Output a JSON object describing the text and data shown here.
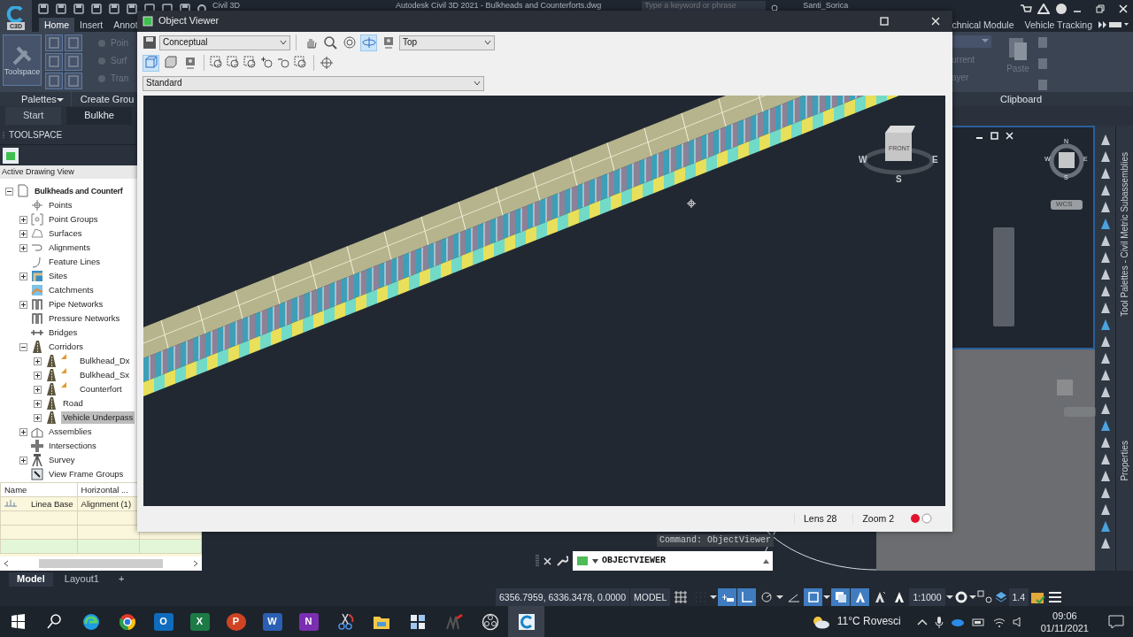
{
  "title_bar": {
    "app_badge": "C3D",
    "app_name": "Civil 3D",
    "document_title": "Autodesk Civil 3D 2021 - Bulkheads and Counterforts.dwg",
    "search": {
      "placeholder": "Type a keyword or phrase"
    },
    "user": "Santi_Sorica"
  },
  "ribbon_tabs_left": [
    {
      "label": "Home",
      "selected": true
    },
    {
      "label": "Insert",
      "selected": false
    },
    {
      "label": "Annot",
      "selected": false
    }
  ],
  "ribbon_tabs_right": [
    {
      "label": "chnical Module",
      "selected": false
    },
    {
      "label": "Vehicle Tracking",
      "selected": false
    }
  ],
  "ribbon_left": {
    "big_button": "Toolspace",
    "faded_items": [
      "Poin",
      "Surf",
      "Tran"
    ],
    "panel_labels": [
      "Palettes",
      "Create Grou"
    ]
  },
  "ribbon_right": {
    "faded_items": [
      "urrent",
      "ayer"
    ],
    "paste": "Paste",
    "panel_label": "Clipboard"
  },
  "file_tabs": [
    {
      "label": "Start",
      "selected": false
    },
    {
      "label": "Bulkhe",
      "selected": true
    }
  ],
  "toolspace": {
    "title": "TOOLSPACE",
    "view": "Active Drawing View",
    "tree": [
      {
        "label": "Bulkheads and Counterf",
        "kind": "document",
        "expanded": true,
        "selected": false,
        "children": [
          {
            "label": "Points",
            "kind": "points",
            "selected": false
          },
          {
            "label": "Point Groups",
            "kind": "point-groups",
            "expanded": false,
            "selected": false
          },
          {
            "label": "Surfaces",
            "kind": "surfaces",
            "expanded": false,
            "selected": false
          },
          {
            "label": "Alignments",
            "kind": "alignments",
            "expanded": false,
            "selected": false
          },
          {
            "label": "Feature Lines",
            "kind": "feature-lines",
            "selected": false
          },
          {
            "label": "Sites",
            "kind": "sites",
            "expanded": false,
            "selected": false
          },
          {
            "label": "Catchments",
            "kind": "catchments",
            "selected": false
          },
          {
            "label": "Pipe Networks",
            "kind": "pipes",
            "expanded": false,
            "selected": false
          },
          {
            "label": "Pressure Networks",
            "kind": "pipes",
            "selected": false
          },
          {
            "label": "Bridges",
            "kind": "bridges",
            "selected": false
          },
          {
            "label": "Corridors",
            "kind": "corridor",
            "expanded": true,
            "selected": false,
            "children": [
              {
                "label": "Bulkhead_Dx",
                "kind": "corridor",
                "flagged": true,
                "expanded": false,
                "selected": false
              },
              {
                "label": "Bulkhead_Sx",
                "kind": "corridor",
                "flagged": true,
                "expanded": false,
                "selected": false
              },
              {
                "label": "Counterfort",
                "kind": "corridor",
                "flagged": true,
                "expanded": false,
                "selected": false
              },
              {
                "label": "Road",
                "kind": "corridor",
                "flagged": false,
                "expanded": false,
                "selected": false
              },
              {
                "label": "Vehicle Underpass",
                "kind": "corridor",
                "flagged": false,
                "expanded": false,
                "selected": true
              }
            ]
          },
          {
            "label": "Assemblies",
            "kind": "assemblies",
            "expanded": false,
            "selected": false
          },
          {
            "label": "Intersections",
            "kind": "intersections",
            "selected": false
          },
          {
            "label": "Survey",
            "kind": "survey",
            "expanded": false,
            "selected": false
          },
          {
            "label": "View Frame Groups",
            "kind": "view-frames",
            "selected": false
          }
        ]
      }
    ],
    "table": {
      "columns": [
        "Name",
        "Horizontal ..."
      ],
      "rows": [
        [
          "Linea Base",
          "Alignment (1)"
        ]
      ]
    }
  },
  "object_viewer": {
    "title": "Object Viewer",
    "visual_style": "Conceptual",
    "view": "Top",
    "display": "Standard",
    "view_tools": [
      {
        "kind": "pan",
        "on": false
      },
      {
        "kind": "zoom",
        "on": false
      },
      {
        "kind": "orbit",
        "on": false
      },
      {
        "kind": "free-orbit",
        "on": true
      },
      {
        "kind": "camera",
        "on": false
      }
    ],
    "shade_tools": [
      {
        "kind": "wire",
        "on": true
      },
      {
        "kind": "solid",
        "on": false
      },
      {
        "kind": "camera",
        "on": false
      }
    ],
    "viewcube": {
      "front": "FRONT",
      "directions": [
        "W",
        "E",
        "S"
      ]
    },
    "lens": "Lens 28",
    "zoom": "Zoom 2"
  },
  "viewports": [
    {
      "kind": "active",
      "compass": [
        "N",
        "W",
        "E",
        "S"
      ],
      "ucs": "WCS"
    },
    {
      "kind": "inactive"
    }
  ],
  "palettes": [
    "Tool Palettes - Civil Metric Subassemblies",
    "Properties"
  ],
  "command_line": {
    "history": "Command: ObjectViewer",
    "input": "OBJECTVIEWER"
  },
  "layout_tabs": [
    {
      "label": "Model",
      "selected": true
    },
    {
      "label": "Layout1",
      "selected": false
    }
  ],
  "layout_add": "+",
  "status_bar": {
    "coordinates": "6356.7959, 6336.3478, 0.0000",
    "space": "MODEL",
    "toggles": [
      {
        "kind": "grid",
        "on": false,
        "menu": false
      },
      {
        "kind": "snap",
        "on": false,
        "menu": true
      },
      {
        "kind": "infer",
        "on": true,
        "menu": false
      },
      {
        "kind": "ortho",
        "on": true,
        "menu": false
      },
      {
        "kind": "polar",
        "on": false,
        "menu": true
      },
      {
        "kind": "angle",
        "on": false,
        "menu": false
      },
      {
        "kind": "osnap",
        "on": true,
        "menu": true
      },
      {
        "kind": "layers",
        "on": true,
        "menu": false
      },
      {
        "kind": "annotation",
        "on": true,
        "menu": false
      },
      {
        "kind": "autoscale",
        "on": false,
        "menu": false
      },
      {
        "kind": "annotation",
        "on": false,
        "menu": false
      }
    ],
    "scale": "1:1000",
    "lineweight": "1.4"
  },
  "taskbar": {
    "apps": [
      {
        "kind": "start",
        "selected": false
      },
      {
        "kind": "search",
        "selected": false
      },
      {
        "kind": "edge",
        "selected": false
      },
      {
        "kind": "chrome",
        "selected": false
      },
      {
        "kind": "tile",
        "glyph": "O",
        "color": "#0f6cbd",
        "selected": false
      },
      {
        "kind": "tile",
        "glyph": "X",
        "color": "#1d7a45",
        "selected": false
      },
      {
        "kind": "round",
        "glyph": "P",
        "color": "#d04423",
        "selected": false
      },
      {
        "kind": "tile",
        "glyph": "W",
        "color": "#2b5fb4",
        "selected": false
      },
      {
        "kind": "tile",
        "glyph": "N",
        "color": "#7b2fb0",
        "selected": false
      },
      {
        "kind": "scissors",
        "selected": false
      },
      {
        "kind": "folder",
        "selected": false
      },
      {
        "kind": "widgets",
        "selected": false
      },
      {
        "kind": "sketch",
        "selected": false
      },
      {
        "kind": "obs",
        "selected": false
      },
      {
        "kind": "civil",
        "selected": true
      }
    ],
    "weather": "11°C Rovesci",
    "time": "09:06",
    "date": "01/11/2021"
  }
}
